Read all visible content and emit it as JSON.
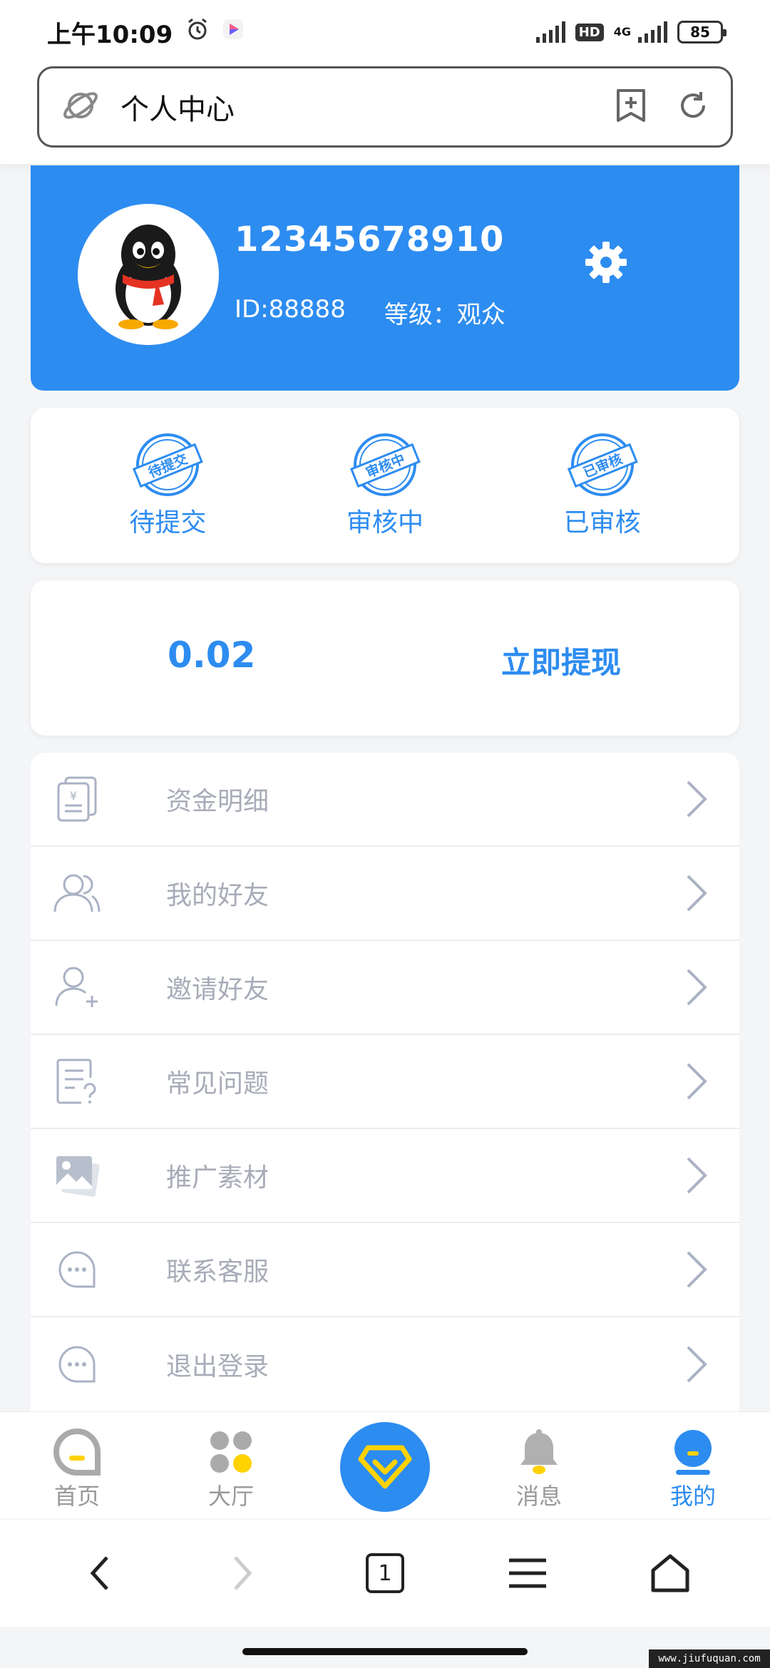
{
  "status_bar": {
    "time": "上午10:09",
    "network_label": "4G",
    "hd_label": "HD",
    "battery": "85"
  },
  "address_bar": {
    "title": "个人中心"
  },
  "profile": {
    "username": "12345678910",
    "id_text": "ID:88888",
    "level_text": "等级：观众"
  },
  "audit": {
    "items": [
      {
        "label": "待提交",
        "stamp": "待提交"
      },
      {
        "label": "审核中",
        "stamp": "审核中"
      },
      {
        "label": "已审核",
        "stamp": "已审核"
      }
    ]
  },
  "withdraw": {
    "balance": "0.02",
    "button_label": "立即提现"
  },
  "menu": {
    "items": [
      {
        "label": "资金明细",
        "icon": "wallet-icon"
      },
      {
        "label": "我的好友",
        "icon": "friends-icon"
      },
      {
        "label": "邀请好友",
        "icon": "add-user-icon"
      },
      {
        "label": "常见问题",
        "icon": "faq-icon"
      },
      {
        "label": "推广素材",
        "icon": "images-icon"
      },
      {
        "label": "联系客服",
        "icon": "chat-icon"
      },
      {
        "label": "退出登录",
        "icon": "logout-chat-icon"
      }
    ]
  },
  "tabbar": {
    "items": [
      {
        "label": "首页"
      },
      {
        "label": "大厅"
      },
      {
        "label": ""
      },
      {
        "label": "消息"
      },
      {
        "label": "我的"
      }
    ],
    "active_index": 4
  },
  "browser_nav": {
    "tab_count": "1"
  },
  "watermark": "www.jiufuquan.com",
  "colors": {
    "primary": "#2d8cf0",
    "menu_text": "#a8acb8",
    "tab_inactive": "#999999",
    "yellow_accent": "#ffd200"
  }
}
